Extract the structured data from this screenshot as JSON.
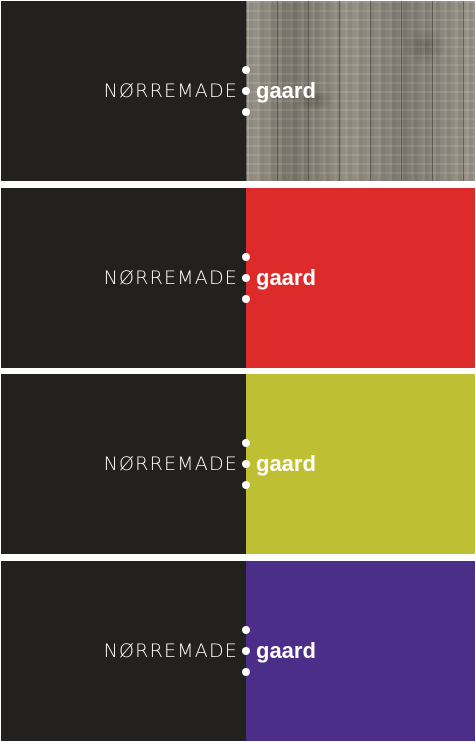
{
  "panels": [
    {
      "brand_left": "NØRREMADE",
      "brand_right": "gaard",
      "swatch": "wood",
      "color": "#8f8a80"
    },
    {
      "brand_left": "NØRREMADE",
      "brand_right": "gaard",
      "swatch": "red",
      "color": "#dd2a2a"
    },
    {
      "brand_left": "NØRREMADE",
      "brand_right": "gaard",
      "swatch": "lime",
      "color": "#bfbf33"
    },
    {
      "brand_left": "NØRREMADE",
      "brand_right": "gaard",
      "swatch": "purple",
      "color": "#4b2e88"
    }
  ],
  "colors": {
    "dark": "#222120",
    "text": "#ffffff",
    "background": "#ffffff"
  }
}
